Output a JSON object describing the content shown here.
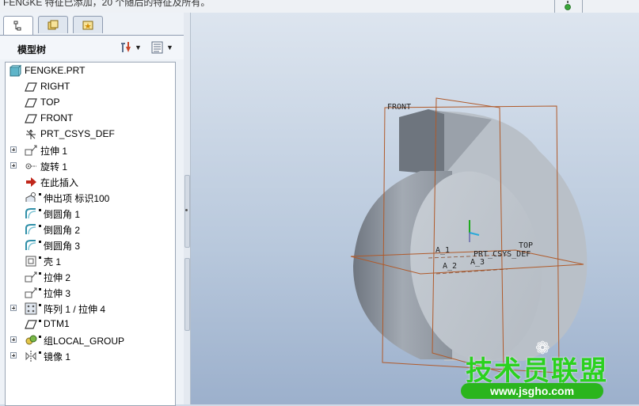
{
  "top": {
    "message": "FENGKE 特征已添加，20 个随后的特征及所有。"
  },
  "panel": {
    "title": "模型树",
    "tabs": [
      {
        "icon": "model-tree-icon",
        "active": true
      },
      {
        "icon": "folder-browser-icon",
        "active": false
      },
      {
        "icon": "favorites-icon",
        "active": false
      }
    ],
    "settings_icon": "tree-settings-icon",
    "columns_icon": "tree-columns-icon"
  },
  "tree": [
    {
      "label": "FENGKE.PRT",
      "icon": "part-icon",
      "expandable": false,
      "flag": false
    },
    {
      "label": "RIGHT",
      "icon": "datum-plane-icon",
      "expandable": false,
      "flag": false
    },
    {
      "label": "TOP",
      "icon": "datum-plane-icon",
      "expandable": false,
      "flag": false
    },
    {
      "label": "FRONT",
      "icon": "datum-plane-icon",
      "expandable": false,
      "flag": false
    },
    {
      "label": "PRT_CSYS_DEF",
      "icon": "csys-icon",
      "expandable": false,
      "flag": false
    },
    {
      "label": "拉伸 1",
      "icon": "extrude-icon",
      "expandable": true,
      "flag": false
    },
    {
      "label": "旋转 1",
      "icon": "revolve-icon",
      "expandable": true,
      "flag": false
    },
    {
      "label": "在此插入",
      "icon": "insert-here-icon",
      "expandable": false,
      "flag": false
    },
    {
      "label": "伸出项 标识100",
      "icon": "protrusion-icon",
      "expandable": false,
      "flag": true
    },
    {
      "label": "倒圆角 1",
      "icon": "round-icon",
      "expandable": false,
      "flag": true
    },
    {
      "label": "倒圆角 2",
      "icon": "round-icon",
      "expandable": false,
      "flag": true
    },
    {
      "label": "倒圆角 3",
      "icon": "round-icon",
      "expandable": false,
      "flag": true
    },
    {
      "label": "壳 1",
      "icon": "shell-icon",
      "expandable": false,
      "flag": true
    },
    {
      "label": "拉伸 2",
      "icon": "extrude-icon",
      "expandable": false,
      "flag": true
    },
    {
      "label": "拉伸 3",
      "icon": "extrude-icon",
      "expandable": false,
      "flag": true
    },
    {
      "label": "阵列 1 / 拉伸 4",
      "icon": "pattern-icon",
      "expandable": true,
      "flag": true
    },
    {
      "label": "DTM1",
      "icon": "datum-plane-icon",
      "expandable": false,
      "flag": true
    },
    {
      "label": "组LOCAL_GROUP",
      "icon": "group-icon",
      "expandable": true,
      "flag": true
    },
    {
      "label": "镜像 1",
      "icon": "mirror-icon",
      "expandable": true,
      "flag": true
    }
  ],
  "viewport": {
    "labels": {
      "front": "FRONT",
      "top": "TOP",
      "csys": "PRT_CSYS_DEF",
      "a1": "A_1",
      "a2": "A_2",
      "a3": "A_3"
    }
  },
  "watermark": {
    "title": "技术员联盟",
    "url": "www.jsgho.com"
  },
  "colors": {
    "datum": "#b05a2a",
    "panel": "#eef2f7",
    "accent": "#2ab51d"
  }
}
